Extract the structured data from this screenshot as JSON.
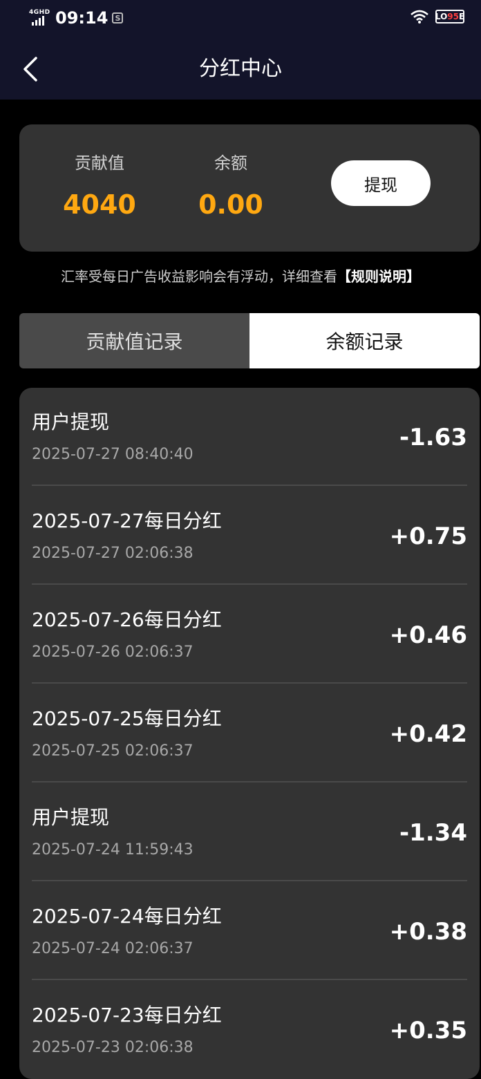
{
  "status_bar": {
    "network": "4GHD",
    "time": "09:14",
    "battery_label": "LO",
    "battery_level": "95",
    "battery_suffix": "E"
  },
  "nav": {
    "title": "分红中心"
  },
  "summary": {
    "contribution_label": "贡献值",
    "contribution_value": "4040",
    "balance_label": "余额",
    "balance_value": "0.00",
    "withdraw_label": "提现",
    "accent_color": "#ffa811"
  },
  "notice": {
    "text": "汇率受每日广告收益影响会有浮动，详细查看",
    "link": "【规则说明】"
  },
  "tabs": [
    {
      "label": "贡献值记录",
      "active": false
    },
    {
      "label": "余额记录",
      "active": true
    }
  ],
  "records": [
    {
      "title": "用户提现",
      "time": "2025-07-27 08:40:40",
      "amount": "-1.63"
    },
    {
      "title": "2025-07-27每日分红",
      "time": "2025-07-27 02:06:38",
      "amount": "+0.75"
    },
    {
      "title": "2025-07-26每日分红",
      "time": "2025-07-26 02:06:37",
      "amount": "+0.46"
    },
    {
      "title": "2025-07-25每日分红",
      "time": "2025-07-25 02:06:37",
      "amount": "+0.42"
    },
    {
      "title": "用户提现",
      "time": "2025-07-24 11:59:43",
      "amount": "-1.34"
    },
    {
      "title": "2025-07-24每日分红",
      "time": "2025-07-24 02:06:37",
      "amount": "+0.38"
    },
    {
      "title": "2025-07-23每日分红",
      "time": "2025-07-23 02:06:38",
      "amount": "+0.35"
    }
  ]
}
